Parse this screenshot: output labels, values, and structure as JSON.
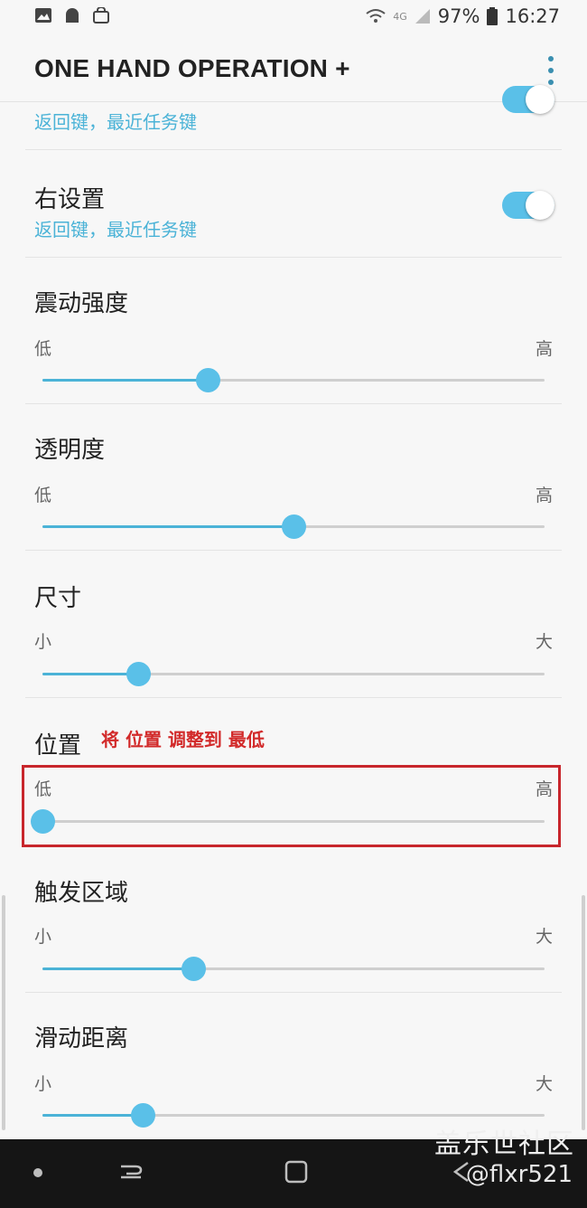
{
  "status_bar": {
    "left_icons": [
      "image-icon",
      "android-icon",
      "shopping-bag-icon"
    ],
    "network": "4G",
    "battery": "97%",
    "time": "16:27"
  },
  "app_bar": {
    "title": "ONE HAND OPERATION +"
  },
  "settings": {
    "left_setting": {
      "subtitle": "返回键，最近任务键",
      "enabled": true
    },
    "right_setting": {
      "title": "右设置",
      "subtitle": "返回键，最近任务键",
      "enabled": true
    },
    "vibration": {
      "title": "震动强度",
      "low": "低",
      "high": "高",
      "value": 0.33
    },
    "transparency": {
      "title": "透明度",
      "low": "低",
      "high": "高",
      "value": 0.5
    },
    "size": {
      "title": "尺寸",
      "low": "小",
      "high": "大",
      "value": 0.19
    },
    "position": {
      "title": "位置",
      "note": "将 位置 调整到 最低",
      "low": "低",
      "high": "高",
      "value": 0.0
    },
    "trigger_area": {
      "title": "触发区域",
      "low": "小",
      "high": "大",
      "value": 0.3
    },
    "swipe_distance": {
      "title": "滑动距离",
      "low": "小",
      "high": "大",
      "value": 0.2
    }
  },
  "watermark": {
    "line1": "盖乐世社区",
    "line2": "@flxr521"
  },
  "colors": {
    "accent": "#5ac0e8",
    "annotation": "#c8262c"
  }
}
